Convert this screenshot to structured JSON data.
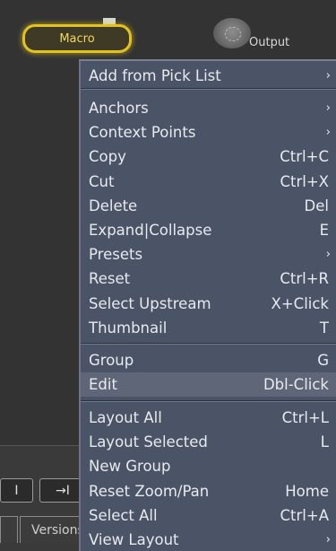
{
  "nodes": {
    "macro_label": "Macro",
    "output_label": "Output"
  },
  "bottom": {
    "button_1": "I",
    "button_2": "→I",
    "tab_versions": "Versions"
  },
  "menu": {
    "groups": [
      [
        {
          "label": "Add from Pick List",
          "shortcut": "",
          "submenu": true
        }
      ],
      [
        {
          "label": "Anchors",
          "shortcut": "",
          "submenu": true
        },
        {
          "label": "Context Points",
          "shortcut": "",
          "submenu": true
        },
        {
          "label": "Copy",
          "shortcut": "Ctrl+C",
          "submenu": false
        },
        {
          "label": "Cut",
          "shortcut": "Ctrl+X",
          "submenu": false
        },
        {
          "label": "Delete",
          "shortcut": "Del",
          "submenu": false
        },
        {
          "label": "Expand|Collapse",
          "shortcut": "E",
          "submenu": false
        },
        {
          "label": "Presets",
          "shortcut": "",
          "submenu": true
        },
        {
          "label": "Reset",
          "shortcut": "Ctrl+R",
          "submenu": false
        },
        {
          "label": "Select Upstream",
          "shortcut": "X+Click",
          "submenu": false
        },
        {
          "label": "Thumbnail",
          "shortcut": "T",
          "submenu": false
        }
      ],
      [
        {
          "label": "Group",
          "shortcut": "G",
          "submenu": false
        },
        {
          "label": "Edit",
          "shortcut": "Dbl-Click",
          "submenu": false,
          "highlighted": true
        }
      ],
      [
        {
          "label": "Layout All",
          "shortcut": "Ctrl+L",
          "submenu": false
        },
        {
          "label": "Layout Selected",
          "shortcut": "L",
          "submenu": false
        },
        {
          "label": "New Group",
          "shortcut": "",
          "submenu": false
        },
        {
          "label": "Reset Zoom/Pan",
          "shortcut": "Home",
          "submenu": false
        },
        {
          "label": "Select All",
          "shortcut": "Ctrl+A",
          "submenu": false
        },
        {
          "label": "View Layout",
          "shortcut": "",
          "submenu": true
        }
      ]
    ],
    "submenu_glyph": "›"
  },
  "colors": {
    "menu_bg": "#4b5366",
    "menu_highlight": "#5e6678",
    "macro_accent": "#e3c21f"
  }
}
